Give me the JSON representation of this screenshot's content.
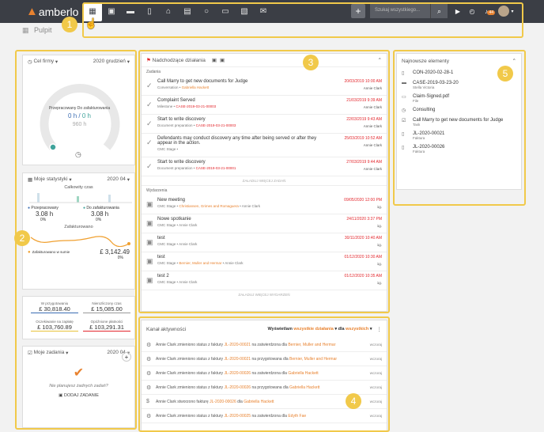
{
  "app": {
    "logo": "amberlo"
  },
  "nav": {
    "icons": [
      "dashboard-icon",
      "calendar-icon",
      "briefcase-icon",
      "document-icon",
      "bank-icon",
      "calendar-grid-icon",
      "chat-icon",
      "folder-icon",
      "notes-icon",
      "mail-icon"
    ]
  },
  "top": {
    "plus": "+",
    "search_placeholder": "Szukaj wszystkiego...",
    "bell_count": "44"
  },
  "breadcrumb": {
    "title": "Pulpit"
  },
  "markers": [
    "1",
    "2",
    "3",
    "4",
    "5"
  ],
  "goal": {
    "title": "Cel firmy",
    "period": "2020 grudzień",
    "label": "Przepracowany Do zafakturowania",
    "value1": "0 h",
    "sep": "/",
    "value2": "0 h",
    "target": "960 h"
  },
  "stats": {
    "title": "Moje statystyki",
    "period": "2020 04",
    "total_label": "Całkowity czas",
    "worked_label": "Przepracowany",
    "worked_value": "3.08 h",
    "worked_pct": "0%",
    "tobill_label": "Do zafakturowania",
    "tobill_value": "3.08 h",
    "tobill_pct": "0%",
    "billed_title": "Zafakturowano",
    "billed_sum_label": "Zafakturowano w sumie",
    "billed_sum": "£ 3,142.49",
    "billed_pct": "0%"
  },
  "money": [
    {
      "label": "W przygotowaniu",
      "value": "£ 30,818.40"
    },
    {
      "label": "Nierozliczony czas",
      "value": "£ 15,085.00"
    },
    {
      "label": "Oczekiwanie na zapłatę",
      "value": "£ 103,760.89"
    },
    {
      "label": "Opóźnione płatności",
      "value": "£ 103,291.31"
    }
  ],
  "tasks": {
    "title": "Moje zadania",
    "period": "2020 04",
    "empty": "Nie planujesz żadnych zadań?",
    "add": "DODAJ ZADANIE"
  },
  "upcoming": {
    "title": "Nadchodzące działania",
    "tasks_header": "Zadania",
    "load_more_tasks": "ZAŁADUJ WIĘCEJ ZADAŃ",
    "events_header": "Wydarzenia",
    "load_more_events": "ZAŁADUJ WIĘCEJ WYDARZEŃ",
    "tasks": [
      {
        "title": "Call Marry to get new documents for Judge",
        "type": "Conversation",
        "link": "Gabriella Hackett",
        "date": "20/03/2019 10:00 AM",
        "who": "Annie Clark"
      },
      {
        "title": "Complaint Served",
        "type": "Milestone",
        "link": "CASE-2019-03-21-00003",
        "date": "21/03/2019 9:39 AM",
        "who": "Annie Clark"
      },
      {
        "title": "Start to write discovery",
        "type": "Document preparation",
        "link": "CASE-2019-03-21-00003",
        "date": "22/03/2019 9:43 AM",
        "who": "Annie Clark"
      },
      {
        "title": "Defendants may conduct discovery any time after being served or after they appear in the action.",
        "type": "CMC Stage",
        "link": "",
        "date": "25/03/2019 10:52 AM",
        "who": "Annie Clark"
      },
      {
        "title": "Start to write discovery",
        "type": "Document preparation",
        "link": "CASE-2019-03-21-00001",
        "date": "27/03/2019 9:44 AM",
        "who": "Annie Clark"
      }
    ],
    "events": [
      {
        "title": "New meeting",
        "type": "CMC Stage",
        "link": "Christiansen, Grimes and Romaguera",
        "who": "Annie Clark",
        "date": "09/05/2020 12:00 PM",
        "dur": "1g."
      },
      {
        "title": "Nowe spotkanie",
        "type": "CMC Stage",
        "link": "",
        "who": "Annie Clark",
        "date": "24/11/2020 3:37 PM",
        "dur": "1g."
      },
      {
        "title": "test",
        "type": "CMC Stage",
        "link": "",
        "who": "Annie Clark",
        "date": "30/11/2020 10:40 AM",
        "dur": "1g."
      },
      {
        "title": "test",
        "type": "CMC Stage",
        "link": "Bernier, Muller and Hermar",
        "who": "Annie Clark",
        "date": "01/12/2020 10:30 AM",
        "dur": "1g."
      },
      {
        "title": "test 2",
        "type": "CMC Stage",
        "link": "",
        "who": "Annie Clark",
        "date": "01/12/2020 10:35 AM",
        "dur": "1g."
      }
    ]
  },
  "activity": {
    "title": "Kanał aktywności",
    "show_label": "Wyświetlam",
    "filter1": "wszystkie działania",
    "for_label": "dla",
    "filter2": "wszystkich",
    "items": [
      {
        "icon": "gear-icon",
        "text": "Annie Clark zmieniono status z faktury",
        "link": "JL-2020-00021",
        "mid": "na zatwierdzona dla",
        "target": "Bernier, Muller and Hermar",
        "when": "wczoraj"
      },
      {
        "icon": "gear-icon",
        "text": "Annie Clark zmieniono status z faktury",
        "link": "JL-2020-00021",
        "mid": "na przygotowana dla",
        "target": "Bernier, Muller and Hermar",
        "when": "wczoraj"
      },
      {
        "icon": "gear-icon",
        "text": "Annie Clark zmieniono status z faktury",
        "link": "JL-2020-00026",
        "mid": "na zatwierdzona dla",
        "target": "Gabriella Hackett",
        "when": "wczoraj"
      },
      {
        "icon": "gear-icon",
        "text": "Annie Clark zmieniono status z faktury",
        "link": "JL-2020-00026",
        "mid": "na przygotowana dla",
        "target": "Gabriella Hackett",
        "when": "wczoraj"
      },
      {
        "icon": "dollar-icon",
        "text": "Annie Clark stworzono fakturę",
        "link": "JL-2020-00026",
        "mid": "dla",
        "target": "Gabriella Hackett",
        "when": "wczoraj"
      },
      {
        "icon": "gear-icon",
        "text": "Annie Clark zmieniono status z faktury",
        "link": "JL-2020-00025",
        "mid": "na zatwierdzona dla",
        "target": "Edyth Fae",
        "when": "wczoraj"
      }
    ]
  },
  "newest": {
    "title": "Najnowsze elementy",
    "items": [
      {
        "icon": "file-icon",
        "title": "CON-2020-02-28-1",
        "sub": ""
      },
      {
        "icon": "briefcase-icon",
        "title": "CASE-2019-03-23-20",
        "sub": "Stella Victoria"
      },
      {
        "icon": "folder-icon",
        "title": "Claim-Signed.pdf",
        "sub": "File"
      },
      {
        "icon": "clock-icon",
        "title": "Consulting",
        "sub": ""
      },
      {
        "icon": "checkbox-icon",
        "title": "Call Marry to get new documents for Judge",
        "sub": "Task"
      },
      {
        "icon": "file-icon",
        "title": "JL-2020-00021",
        "sub": "Faktura"
      },
      {
        "icon": "file-icon",
        "title": "JL-2020-00026",
        "sub": "Faktura"
      }
    ]
  }
}
